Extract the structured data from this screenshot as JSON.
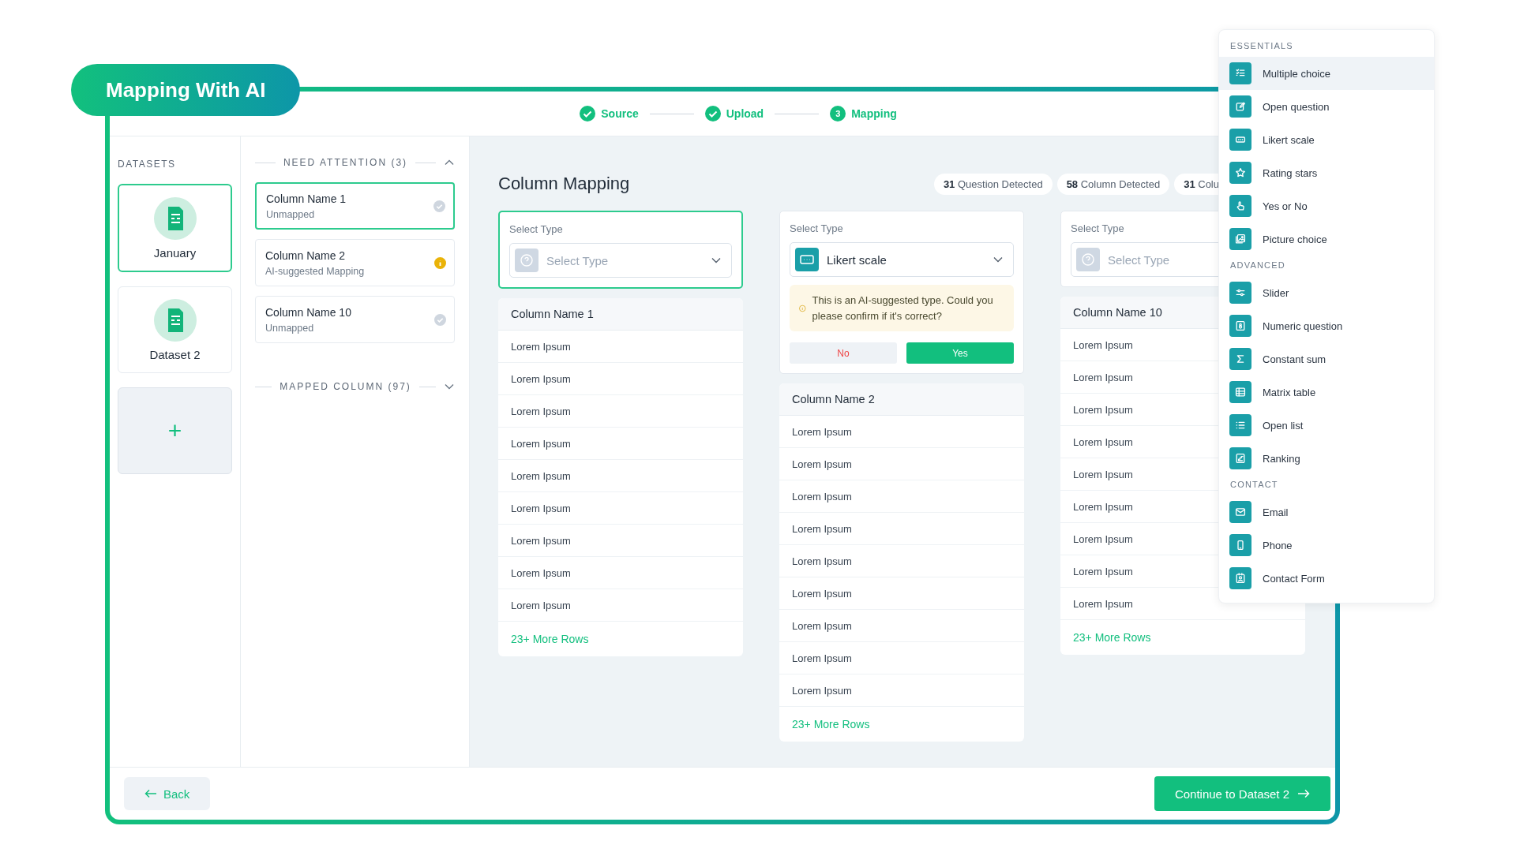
{
  "title": "Mapping With AI",
  "steps": [
    {
      "label": "Source",
      "done": true
    },
    {
      "label": "Upload",
      "done": true
    },
    {
      "label": "Mapping",
      "done": false,
      "number": "3"
    }
  ],
  "datasets": {
    "heading": "DATASETS",
    "items": [
      {
        "name": "January",
        "selected": true
      },
      {
        "name": "Dataset 2",
        "selected": false
      }
    ],
    "add": "+"
  },
  "need_attention": {
    "heading": "NEED ATTENTION (3)",
    "expanded": true,
    "items": [
      {
        "name": "Column Name 1",
        "status_text": "Unmapped",
        "suggested": false,
        "selected": true
      },
      {
        "name": "Column Name 2",
        "status_text": "AI-suggested Mapping",
        "suggested": true,
        "selected": false
      },
      {
        "name": "Column Name 10",
        "status_text": "Unmapped",
        "suggested": false,
        "selected": false
      }
    ]
  },
  "mapped_column": {
    "heading": "MAPPED COLUMN (97)",
    "expanded": false
  },
  "mapping": {
    "title": "Column Mapping",
    "chips": [
      {
        "count": "31",
        "label": "Question Detected"
      },
      {
        "count": "58",
        "label": "Column Detected"
      },
      {
        "count": "31",
        "label": "Colu"
      }
    ],
    "columns": [
      {
        "select_label": "Select Type",
        "placeholder": "Select Type",
        "selected": true,
        "name": "Column Name 1",
        "rows": [
          "Lorem Ipsum",
          "Lorem Ipsum",
          "Lorem Ipsum",
          "Lorem Ipsum",
          "Lorem Ipsum",
          "Lorem Ipsum",
          "Lorem Ipsum",
          "Lorem Ipsum",
          "Lorem Ipsum"
        ],
        "more": "23+ More Rows"
      },
      {
        "select_label": "Select Type",
        "value": "Likert scale",
        "selected": false,
        "notice": "This is an AI-suggested type. Could you please confirm if it's correct?",
        "no": "No",
        "yes": "Yes",
        "name": "Column Name 2",
        "rows": [
          "Lorem Ipsum",
          "Lorem Ipsum",
          "Lorem Ipsum",
          "Lorem Ipsum",
          "Lorem Ipsum",
          "Lorem Ipsum",
          "Lorem Ipsum",
          "Lorem Ipsum",
          "Lorem Ipsum"
        ],
        "more": "23+ More Rows"
      },
      {
        "select_label": "Select Type",
        "placeholder": "Select Type",
        "selected": false,
        "name": "Column Name 10",
        "rows": [
          "Lorem Ipsum",
          "Lorem Ipsum",
          "Lorem Ipsum",
          "Lorem Ipsum",
          "Lorem Ipsum",
          "Lorem Ipsum",
          "Lorem Ipsum",
          "Lorem Ipsum",
          "Lorem Ipsum"
        ],
        "more": "23+ More Rows"
      }
    ]
  },
  "footer": {
    "back": "Back",
    "continue": "Continue to Dataset 2"
  },
  "type_menu": [
    {
      "heading": "ESSENTIALS",
      "items": [
        {
          "label": "Multiple choice",
          "selected": true
        },
        {
          "label": "Open question",
          "selected": false
        },
        {
          "label": "Likert scale",
          "selected": false
        },
        {
          "label": "Rating stars",
          "selected": false
        },
        {
          "label": "Yes or No",
          "selected": false
        },
        {
          "label": "Picture choice",
          "selected": false
        }
      ]
    },
    {
      "heading": "ADVANCED",
      "items": [
        {
          "label": "Slider",
          "selected": false
        },
        {
          "label": "Numeric question",
          "selected": false
        },
        {
          "label": "Constant sum",
          "selected": false
        },
        {
          "label": "Matrix table",
          "selected": false
        },
        {
          "label": "Open list",
          "selected": false
        },
        {
          "label": "Ranking",
          "selected": false
        }
      ]
    },
    {
      "heading": "CONTACT",
      "items": [
        {
          "label": "Email",
          "selected": false
        },
        {
          "label": "Phone",
          "selected": false
        },
        {
          "label": "Contact Form",
          "selected": false
        }
      ]
    }
  ]
}
